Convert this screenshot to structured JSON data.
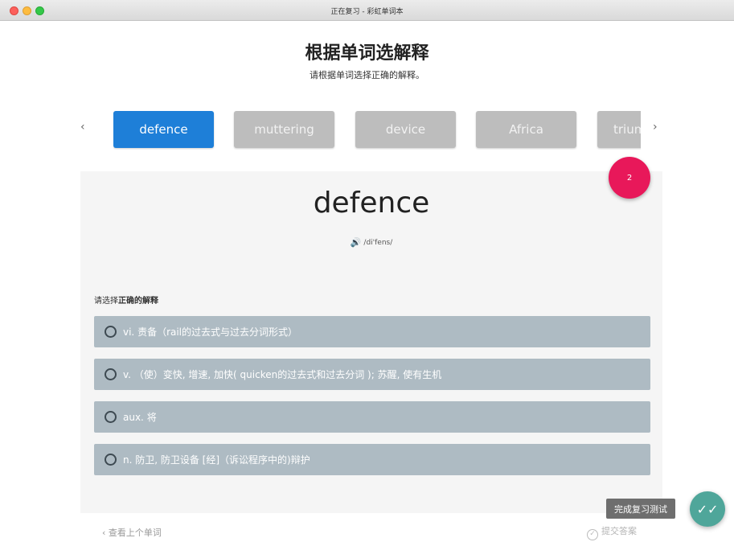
{
  "window": {
    "title": "正在复习 - 彩虹单词本"
  },
  "header": {
    "title": "根据单词选解释",
    "subtitle": "请根据单词选择正确的解释。"
  },
  "word_strip": {
    "tabs": [
      {
        "label": "defence",
        "active": true
      },
      {
        "label": "muttering",
        "active": false
      },
      {
        "label": "device",
        "active": false
      },
      {
        "label": "Africa",
        "active": false
      },
      {
        "label": "triumph",
        "active": false
      }
    ],
    "prev_icon": "chevron-left-icon",
    "next_icon": "chevron-right-icon"
  },
  "badge": {
    "count": "2"
  },
  "card": {
    "word": "defence",
    "phonetic": "/di'fens/",
    "speaker_icon": "speaker-icon"
  },
  "question": {
    "prompt_prefix": "请选择",
    "prompt_bold": "正确的解释",
    "options": [
      "vi. 责备（rail的过去式与过去分词形式）",
      "v. （使）变快, 增速, 加快( quicken的过去式和过去分词 ); 苏醒, 使有生机",
      "aux. 将",
      "n. 防卫, 防卫设备 [经]（诉讼程序中的)辩护"
    ]
  },
  "footer": {
    "prev_label": "查看上个单词",
    "submit_label": "提交答案"
  },
  "fab": {
    "tooltip": "完成复习测试",
    "icon": "double-check-icon"
  },
  "colors": {
    "accent": "#1e7fd8",
    "badge": "#e8185a",
    "option_bg": "#aebbc3",
    "fab": "#4fa69a"
  }
}
